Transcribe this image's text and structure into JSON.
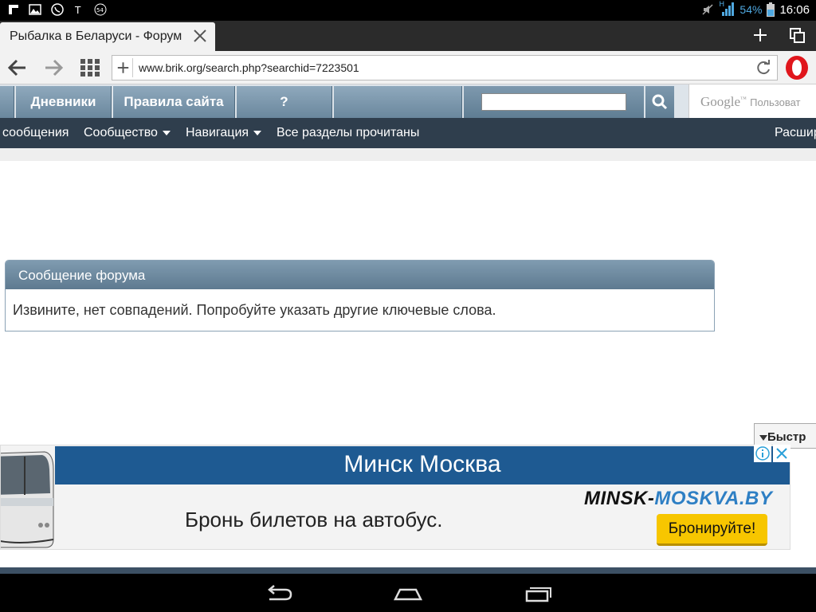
{
  "status_bar": {
    "battery_percent": "54%",
    "time": "16:06",
    "notification_count": "54",
    "network_label": "H"
  },
  "browser": {
    "tab_title": "Рыбалка в Беларуси - Форум",
    "url": "www.brik.org/search.php?searchid=7223501"
  },
  "forum_nav": {
    "tabs": [
      "Дневники",
      "Правила сайта",
      "?"
    ],
    "google_label": "Google",
    "google_tm": "™",
    "google_sub": "Пользоват"
  },
  "subnav": {
    "items": [
      "сообщения",
      "Сообщество",
      "Навигация",
      "Все разделы прочитаны"
    ],
    "right": "Расшир"
  },
  "message_box": {
    "title": "Сообщение форума",
    "body": "Извините, нет совпадений. Попробуйте указать другие ключевые слова."
  },
  "quick_reply": {
    "label": "Быстр"
  },
  "ad": {
    "headline": "Минск Москва",
    "description": "Бронь билетов на автобус.",
    "brand_part1": "MINSK-",
    "brand_part2": "MOSKVA.BY",
    "cta": "Бронируйте!",
    "brand_color": "#2e7fc4",
    "banner_color": "#1e5a92",
    "cta_color": "#f7c600"
  }
}
